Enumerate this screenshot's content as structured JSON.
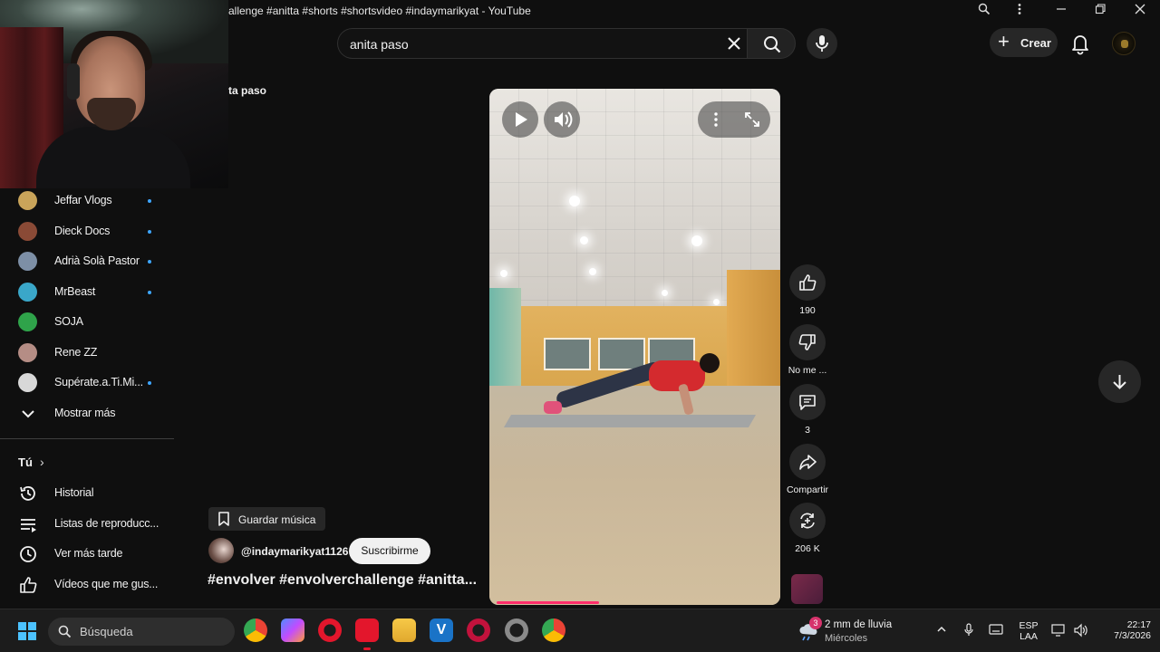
{
  "window": {
    "title": "allenge #anitta #shorts #shortsvideo #indaymarikyat - YouTube"
  },
  "masthead": {
    "search_value": "anita paso",
    "create_label": "Crear"
  },
  "query_crumb": "ta paso",
  "sidebar": {
    "subscriptions": [
      {
        "label": "Jeffar Vlogs",
        "new": true,
        "color": "#c9a45a"
      },
      {
        "label": "Dieck Docs",
        "new": true,
        "color": "#8a4a36"
      },
      {
        "label": "Adrià Solà Pastor",
        "new": true,
        "color": "#7d8fa6"
      },
      {
        "label": "MrBeast",
        "new": true,
        "color": "#3aa7c9"
      },
      {
        "label": "SOJA",
        "new": false,
        "color": "#2fa34a"
      },
      {
        "label": "Rene ZZ",
        "new": false,
        "color": "#b58d85"
      },
      {
        "label": "Supérate.a.Ti.Mi...",
        "new": true,
        "color": "#d8d8d8"
      }
    ],
    "show_more_label": "Mostrar más",
    "you_label": "Tú",
    "you_items": [
      {
        "label": "Historial",
        "icon": "history-icon"
      },
      {
        "label": "Listas de reproducc...",
        "icon": "playlists-icon"
      },
      {
        "label": "Ver más tarde",
        "icon": "watch-later-icon"
      },
      {
        "label": "Vídeos que me gus...",
        "icon": "liked-videos-icon"
      }
    ]
  },
  "short": {
    "save_music_label": "Guardar música",
    "channel": "@indaymarikyat1126",
    "subscribe_label": "Suscribirme",
    "title": "#envolver #envolverchallenge #anitta...",
    "progress_fraction": 0.37
  },
  "actions": {
    "likes": "190",
    "dislike_label": "No me ...",
    "comments": "3",
    "share_label": "Compartir",
    "remix_count": "206 K"
  },
  "taskbar": {
    "search_label": "Búsqueda",
    "weather_line1": "2 mm de lluvia",
    "weather_line2": "Miércoles",
    "weather_badge": "3",
    "lang_line1": "ESP",
    "lang_line2": "LAA",
    "time": "22:17",
    "date": "7/3/2026"
  }
}
